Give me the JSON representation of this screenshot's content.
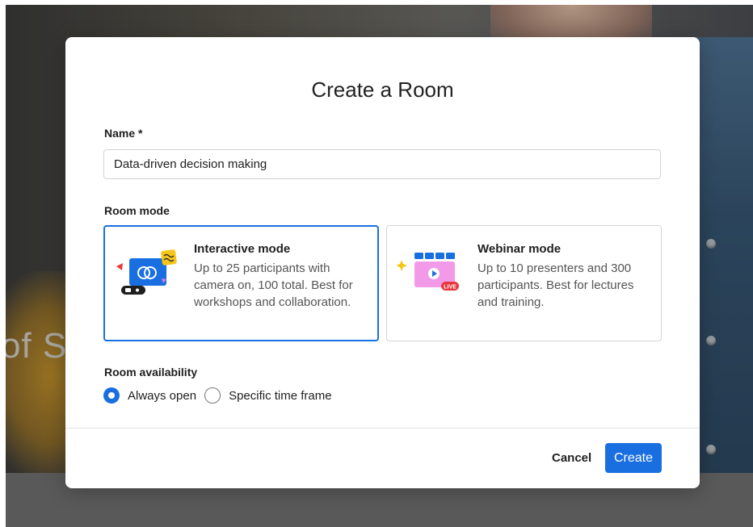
{
  "background": {
    "text": "of S"
  },
  "dialog": {
    "title": "Create a Room",
    "name_label": "Name *",
    "name_value": "Data-driven decision making",
    "room_mode_label": "Room mode",
    "modes": [
      {
        "title": "Interactive mode",
        "description": "Up to 25 participants with camera on, 100 total. Best for workshops and collaboration.",
        "selected": true,
        "icon": "interactive-mode-illustration"
      },
      {
        "title": "Webinar mode",
        "description": "Up to 10 presenters and 300 participants. Best for lectures and training.",
        "selected": false,
        "icon": "webinar-mode-illustration",
        "badge": "LIVE"
      }
    ],
    "availability_label": "Room availability",
    "availability_options": [
      {
        "label": "Always open",
        "selected": true
      },
      {
        "label": "Specific time frame",
        "selected": false
      }
    ],
    "cancel_label": "Cancel",
    "create_label": "Create"
  },
  "colors": {
    "accent": "#1a6fe0",
    "text": "#1f1f1f",
    "muted_text": "#555555",
    "border": "#d2d5d9"
  }
}
